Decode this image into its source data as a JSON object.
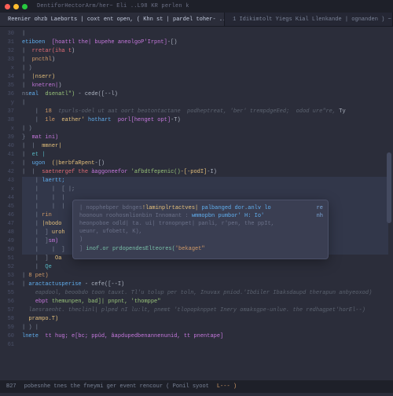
{
  "window": {
    "title": "DentiforHectorArm/her~ Eli ..L98  KR perlen k"
  },
  "tabs": [
    {
      "label": "Reenier ohzb Laeborts | coxt ent open,  ( Khn st  | pardel toher-   ...  ) ——)",
      "active": true
    },
    {
      "label": "1  Idikimtolt Yiegs Kial Llenkande | ognanden )    ~    * | ——",
      "active": false
    }
  ],
  "gutter_lines": [
    "30",
    "31",
    "32",
    "33",
    "x",
    "34",
    "35",
    "36",
    "y",
    "37",
    "38",
    "x",
    "39",
    "40",
    "41",
    "x",
    "42",
    "43",
    "x",
    "44",
    "45",
    "46",
    "47",
    "48",
    "49",
    "50",
    "51",
    "52",
    "53",
    "54",
    "55",
    "",
    "56",
    "57",
    "",
    "58",
    "59",
    "60",
    "",
    "61"
  ],
  "code": [
    {
      "indent": 0,
      "frags": [
        {
          "t": "|  ",
          "c": "br"
        }
      ]
    },
    {
      "indent": 0,
      "frags": [
        {
          "t": "etiboen  ",
          "c": "fn"
        },
        {
          "t": "[hoattl the| bupehe aneolgoP'Irpnt]",
          "c": "kw"
        },
        {
          "t": "-[)",
          "c": "p"
        }
      ]
    },
    {
      "indent": 0,
      "frags": [
        {
          "t": "|  ",
          "c": "br"
        },
        {
          "t": "rretar(iha t",
          "c": "ret"
        },
        {
          "t": ")",
          "c": "p"
        }
      ]
    },
    {
      "indent": 0,
      "frags": [
        {
          "t": "|  ",
          "c": "br"
        },
        {
          "t": "pncthl",
          "c": "def"
        },
        {
          "t": ")",
          "c": "p"
        }
      ]
    },
    {
      "indent": 0,
      "frags": [
        {
          "t": "| )",
          "c": "br"
        }
      ]
    },
    {
      "indent": 0,
      "frags": [
        {
          "t": "|  ",
          "c": "br"
        },
        {
          "t": "|nserr)",
          "c": "id"
        }
      ]
    },
    {
      "indent": 0,
      "frags": [
        {
          "t": "|  ",
          "c": "br"
        },
        {
          "t": "knetren|",
          "c": "kw"
        },
        {
          "t": ")",
          "c": "p"
        }
      ]
    },
    {
      "indent": 0,
      "frags": [
        {
          "t": "ns",
          "c": "br"
        },
        {
          "t": "eal  ",
          "c": "fn"
        },
        {
          "t": "dsenatl\")",
          "c": "str"
        },
        {
          "t": " - cede([--l)",
          "c": "p"
        }
      ]
    },
    {
      "indent": 0,
      "frags": [
        {
          "t": "|",
          "c": "br"
        }
      ]
    },
    {
      "indent": 0,
      "frags": [
        {
          "t": "    |  ",
          "c": "br"
        },
        {
          "t": "18  ",
          "c": "def"
        },
        {
          "t": "tpurls-odel ut aat oort beotontactane  podheptreat, 'ber' trempdgeEed;  odod ure\"re,",
          "c": "cmt"
        },
        {
          "t": " Ty",
          "c": "p"
        }
      ]
    },
    {
      "indent": 0,
      "frags": [
        {
          "t": "    |  ",
          "c": "br"
        },
        {
          "t": "1le  ",
          "c": "def"
        },
        {
          "t": "eather' ",
          "c": "id"
        },
        {
          "t": "hothart  ",
          "c": "fn"
        },
        {
          "t": "porl[henget opt]",
          "c": "kw"
        },
        {
          "t": "-T)",
          "c": "p"
        }
      ]
    },
    {
      "indent": 0,
      "frags": [
        {
          "t": "| )",
          "c": "br"
        }
      ]
    },
    {
      "indent": 0,
      "frags": [
        {
          "t": "}  ",
          "c": "br"
        },
        {
          "t": "mat ini)",
          "c": "kw"
        }
      ]
    },
    {
      "indent": 0,
      "frags": [
        {
          "t": "|  |  ",
          "c": "br"
        },
        {
          "t": "mmner|",
          "c": "id"
        }
      ]
    },
    {
      "indent": 0,
      "frags": [
        {
          "t": "|  ",
          "c": "br"
        },
        {
          "t": "et |",
          "c": "op"
        }
      ]
    },
    {
      "indent": 0,
      "frags": [
        {
          "t": "|  ",
          "c": "br"
        },
        {
          "t": "ugon  ",
          "c": "fn"
        },
        {
          "t": "(|berbfaRpent",
          "c": "id"
        },
        {
          "t": "-[)",
          "c": "p"
        }
      ]
    },
    {
      "indent": 0,
      "frags": [
        {
          "t": "|  |  ",
          "c": "br"
        },
        {
          "t": "saetnergef the ",
          "c": "ret"
        },
        {
          "t": "àaggoneefor ",
          "c": "kw"
        },
        {
          "t": "'afbdtfepenic()",
          "c": "str"
        },
        {
          "t": "-[-podI]",
          "c": "id"
        },
        {
          "t": "-I)",
          "c": "p"
        }
      ]
    },
    {
      "indent": 0,
      "frags": [
        {
          "t": "",
          "c": "p"
        }
      ]
    },
    {
      "indent": 0,
      "hl": true,
      "frags": [
        {
          "t": "    | ",
          "c": "br"
        },
        {
          "t": "laertt;",
          "c": "fn"
        }
      ]
    },
    {
      "indent": 0,
      "hl": true,
      "frags": [
        {
          "t": "    |",
          "c": "br"
        },
        {
          "t": "    |  [ |;",
          "c": "br"
        }
      ]
    },
    {
      "indent": 0,
      "hl": true,
      "frags": [
        {
          "t": "    |",
          "c": "br"
        },
        {
          "t": "    |  |  ",
          "c": "br"
        },
        {
          "t": "   ",
          "c": "p"
        }
      ]
    },
    {
      "indent": 0,
      "hl": true,
      "frags": [
        {
          "t": "    |",
          "c": "br"
        },
        {
          "t": "    |  |  ",
          "c": "br"
        }
      ]
    },
    {
      "indent": 0,
      "hl": true,
      "frags": [
        {
          "t": "    | ",
          "c": "br"
        },
        {
          "t": "rin",
          "c": "def"
        }
      ]
    },
    {
      "indent": 0,
      "hl": true,
      "frags": [
        {
          "t": "    | ",
          "c": "br"
        },
        {
          "t": "|nbodo",
          "c": "id"
        }
      ]
    },
    {
      "indent": 0,
      "hl": true,
      "frags": [
        {
          "t": "    |",
          "c": "br"
        },
        {
          "t": "  ] ",
          "c": "br"
        },
        {
          "t": "uroh",
          "c": "id"
        }
      ]
    },
    {
      "indent": 0,
      "hl": true,
      "frags": [
        {
          "t": "    |",
          "c": "br"
        },
        {
          "t": "  ]",
          "c": "br"
        },
        {
          "t": "sm)",
          "c": "kw"
        }
      ]
    },
    {
      "indent": 0,
      "hl": true,
      "frags": [
        {
          "t": "    |",
          "c": "br"
        },
        {
          "t": "    |  ]",
          "c": "br"
        }
      ]
    },
    {
      "indent": 0,
      "frags": [
        {
          "t": "    |",
          "c": "br"
        },
        {
          "t": "  ]  ",
          "c": "br"
        },
        {
          "t": "Oa",
          "c": "id"
        }
      ]
    },
    {
      "indent": 0,
      "frags": [
        {
          "t": "    |  ",
          "c": "br"
        },
        {
          "t": "Qe",
          "c": "op"
        }
      ]
    },
    {
      "indent": 0,
      "frags": [
        {
          "t": "| ",
          "c": "br"
        },
        {
          "t": "8 pet)",
          "c": "def"
        }
      ]
    },
    {
      "indent": 0,
      "frags": [
        {
          "t": "| ",
          "c": "br"
        },
        {
          "t": "aractactusperise",
          "c": "fn"
        },
        {
          "t": " - cefe([--I)",
          "c": "p"
        }
      ]
    },
    {
      "indent": 0,
      "frags": [
        {
          "t": "",
          "c": "p"
        }
      ]
    },
    {
      "indent": 0,
      "frags": [
        {
          "t": "    ",
          "c": "br"
        },
        {
          "t": "eapdool, beoobdo toon tauxt. Tl'u tolup per toln, Inuvax pniod.'Ibdiler Ibaksdaupd therapun anbyeoxod)",
          "c": "cmt"
        }
      ]
    },
    {
      "indent": 0,
      "frags": [
        {
          "t": "",
          "c": "p"
        }
      ]
    },
    {
      "indent": 0,
      "frags": [
        {
          "t": "",
          "c": "p"
        }
      ]
    },
    {
      "indent": 0,
      "frags": [
        {
          "t": "    ",
          "c": "br"
        },
        {
          "t": "ebpt ",
          "c": "kw"
        },
        {
          "t": "themunpen, bad]| pnpnt, 'thomppe\"",
          "c": "str"
        }
      ]
    },
    {
      "indent": 0,
      "frags": [
        {
          "t": "  ",
          "c": "br"
        },
        {
          "t": "laesraenht. theclinl| plped nI lu:lt, pnemt 'tlopopknppet Inery omaksgpe-unlue. the redhagpet'horEl--)",
          "c": "cmt"
        }
      ]
    },
    {
      "indent": 0,
      "frags": [
        {
          "t": "  ",
          "c": "br"
        },
        {
          "t": "prampo.T)",
          "c": "id"
        }
      ]
    },
    {
      "indent": 0,
      "frags": [
        {
          "t": "| ) |",
          "c": "br"
        }
      ]
    },
    {
      "indent": 0,
      "frags": [
        {
          "t": "lnete  ",
          "c": "fn"
        },
        {
          "t": "tt hug; e[bc; ppûd, âapdupedbenannenunid, tt pnentape]",
          "c": "kw"
        }
      ]
    }
  ],
  "popup": {
    "sig_prefix": "| nopphebper bdnges",
    "sig_name": "!laminplrtactves|",
    "sig_suffix": " palbanged dor.anlv  lo",
    "line2": "hoonoun   roohosmlionbin  Innomant    :",
    "line2b": " wmmopbn pumbor'  H: Io'",
    "line3a": "heonpoboe    odld| ta. ui| tronopnpet| panli, r'pen, the  ppIt,",
    "line3b": "ueunr, ufobett,  K),",
    "brace": ")",
    "footer_prefix": "] ",
    "footer": "inof.or prdopendesElteores(",
    "footer_arg": "'bekaget\"",
    "re": "re",
    "nh": "nh"
  },
  "statusbar": {
    "ln": "B27",
    "msg": "pobesnhe tnes  the fneymi ger event   rencour ( Ponil  syoot",
    "tail": "L---  )"
  }
}
